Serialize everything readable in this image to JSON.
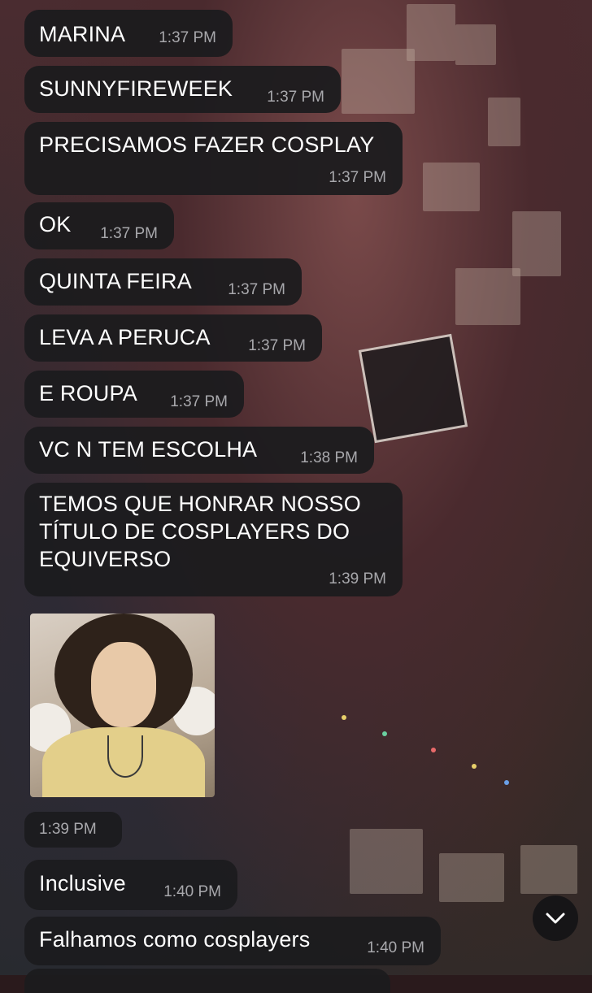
{
  "messages": [
    {
      "text": "MARINA",
      "time": "1:37 PM"
    },
    {
      "text": "SUNNYFIREWEEK",
      "time": "1:37 PM"
    },
    {
      "text": "PRECISAMOS FAZER COSPLAY",
      "time": "1:37 PM"
    },
    {
      "text": "OK",
      "time": "1:37 PM"
    },
    {
      "text": "QUINTA FEIRA",
      "time": "1:37 PM"
    },
    {
      "text": "LEVA A PERUCA",
      "time": "1:37 PM"
    },
    {
      "text": "E ROUPA",
      "time": "1:37 PM"
    },
    {
      "text": "VC N TEM ESCOLHA",
      "time": "1:38 PM"
    },
    {
      "text": "TEMOS QUE HONRAR NOSSO\nTÍTULO DE COSPLAYERS DO\nEQUIVERSO",
      "time": "1:39 PM"
    },
    {
      "text": "Inclusive",
      "time": "1:40 PM"
    },
    {
      "text": "Falhamos como cosplayers",
      "time": "1:40 PM"
    }
  ],
  "photo_message": {
    "time": "1:39 PM",
    "content": "photo of a curly-haired person wearing a yellow shirt and necklace"
  },
  "scroll_button": {
    "icon": "chevron-down-icon"
  },
  "colors": {
    "bubble": "#1c1c1e",
    "text": "#ffffff",
    "timestamp": "#a8a8ac"
  }
}
